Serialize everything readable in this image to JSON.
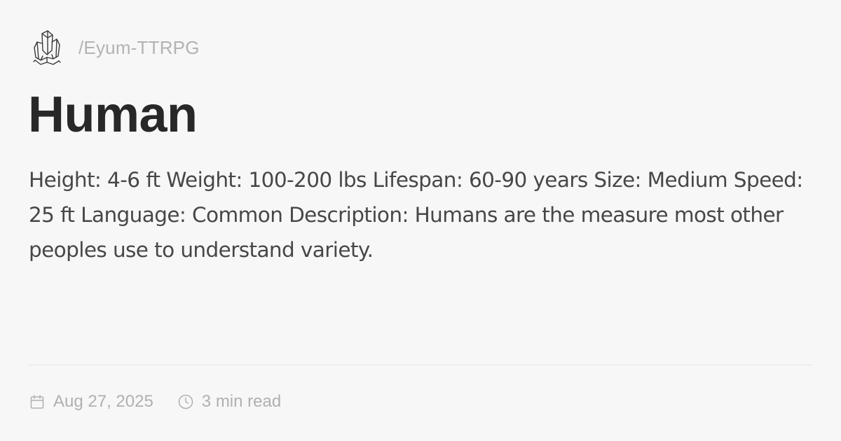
{
  "site": {
    "logo_icon": "crystal-icon",
    "breadcrumb": "/Eyum-TTRPG"
  },
  "page": {
    "title": "Human",
    "description": "Height: 4-6 ft Weight: 100-200 lbs Lifespan: 60-90 years Size: Medium Speed: 25 ft Language: Common Description: Humans are the measure most other peoples use to understand variety."
  },
  "meta": {
    "date_icon": "calendar-icon",
    "date": "Aug 27, 2025",
    "read_time_icon": "clock-icon",
    "read_time": "3 min read"
  },
  "colors": {
    "background": "#f8f7f8",
    "title": "#282828",
    "body_text": "#474747",
    "muted": "#b0b0b0",
    "divider": "#e6e6e6"
  }
}
